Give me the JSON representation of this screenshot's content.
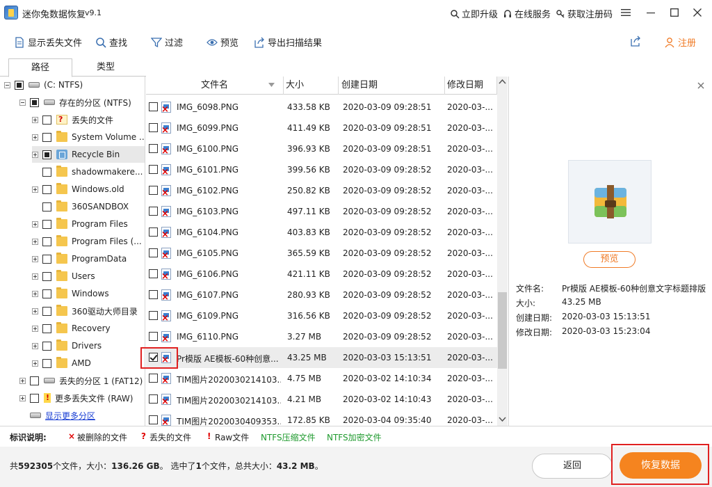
{
  "app": {
    "title": "迷你兔数据恢复",
    "version": "v9.1"
  },
  "titlebar": {
    "upgrade": "立即升级",
    "online_service": "在线服务",
    "get_code": "获取注册码"
  },
  "toolbar": {
    "show_lost": "显示丢失文件",
    "find": "查找",
    "filter": "过滤",
    "preview": "预览",
    "export": "导出扫描结果",
    "register": "注册"
  },
  "tabs": [
    "路径",
    "类型"
  ],
  "tree": [
    {
      "label": "(C: NTFS)",
      "icon": "drive",
      "check": "partial",
      "exp": "minus"
    },
    {
      "label": "存在的分区 (NTFS)",
      "icon": "drive",
      "check": "partial",
      "exp": "minus"
    },
    {
      "label": "丢失的文件",
      "icon": "lost",
      "check": "none",
      "exp": "plus"
    },
    {
      "label": "System Volume ...",
      "icon": "folder",
      "check": "none",
      "exp": "plus"
    },
    {
      "label": "Recycle Bin",
      "icon": "recycle",
      "check": "partial",
      "exp": "plus"
    },
    {
      "label": "shadowmakere...",
      "icon": "folder",
      "check": "none",
      "exp": "none"
    },
    {
      "label": "Windows.old",
      "icon": "folder",
      "check": "none",
      "exp": "plus"
    },
    {
      "label": "360SANDBOX",
      "icon": "folder",
      "check": "none",
      "exp": "none"
    },
    {
      "label": "Program Files",
      "icon": "folder",
      "check": "none",
      "exp": "plus"
    },
    {
      "label": "Program Files (...",
      "icon": "folder",
      "check": "none",
      "exp": "plus"
    },
    {
      "label": "ProgramData",
      "icon": "folder",
      "check": "none",
      "exp": "plus"
    },
    {
      "label": "Users",
      "icon": "folder",
      "check": "none",
      "exp": "plus"
    },
    {
      "label": "Windows",
      "icon": "folder",
      "check": "none",
      "exp": "plus"
    },
    {
      "label": "360驱动大师目录",
      "icon": "folder",
      "check": "none",
      "exp": "plus"
    },
    {
      "label": "Recovery",
      "icon": "folder",
      "check": "none",
      "exp": "plus"
    },
    {
      "label": "Drivers",
      "icon": "folder",
      "check": "none",
      "exp": "plus"
    },
    {
      "label": "AMD",
      "icon": "folder",
      "check": "none",
      "exp": "plus"
    },
    {
      "label": "丢失的分区 1 (FAT12)",
      "icon": "drive",
      "check": "none",
      "exp": "plus"
    },
    {
      "label": "更多丢失文件 (RAW)",
      "icon": "warn",
      "check": "none",
      "exp": "plus"
    },
    {
      "label": "显示更多分区",
      "icon": "drive",
      "check": "hidden",
      "exp": "none"
    }
  ],
  "list": {
    "headers": {
      "name": "文件名",
      "size": "大小",
      "created": "创建日期",
      "modified": "修改日期"
    },
    "rows": [
      {
        "name": "IMG_6098.PNG",
        "size": "433.58 KB",
        "created": "2020-03-09 09:28:51",
        "modified": "2020-03-...",
        "checked": false
      },
      {
        "name": "IMG_6099.PNG",
        "size": "411.49 KB",
        "created": "2020-03-09 09:28:51",
        "modified": "2020-03-...",
        "checked": false
      },
      {
        "name": "IMG_6100.PNG",
        "size": "396.93 KB",
        "created": "2020-03-09 09:28:51",
        "modified": "2020-03-...",
        "checked": false
      },
      {
        "name": "IMG_6101.PNG",
        "size": "399.56 KB",
        "created": "2020-03-09 09:28:52",
        "modified": "2020-03-...",
        "checked": false
      },
      {
        "name": "IMG_6102.PNG",
        "size": "250.82 KB",
        "created": "2020-03-09 09:28:52",
        "modified": "2020-03-...",
        "checked": false
      },
      {
        "name": "IMG_6103.PNG",
        "size": "497.11 KB",
        "created": "2020-03-09 09:28:52",
        "modified": "2020-03-...",
        "checked": false
      },
      {
        "name": "IMG_6104.PNG",
        "size": "403.83 KB",
        "created": "2020-03-09 09:28:52",
        "modified": "2020-03-...",
        "checked": false
      },
      {
        "name": "IMG_6105.PNG",
        "size": "365.59 KB",
        "created": "2020-03-09 09:28:52",
        "modified": "2020-03-...",
        "checked": false
      },
      {
        "name": "IMG_6106.PNG",
        "size": "421.11 KB",
        "created": "2020-03-09 09:28:52",
        "modified": "2020-03-...",
        "checked": false
      },
      {
        "name": "IMG_6107.PNG",
        "size": "280.93 KB",
        "created": "2020-03-09 09:28:52",
        "modified": "2020-03-...",
        "checked": false
      },
      {
        "name": "IMG_6109.PNG",
        "size": "316.56 KB",
        "created": "2020-03-09 09:28:52",
        "modified": "2020-03-...",
        "checked": false
      },
      {
        "name": "IMG_6110.PNG",
        "size": "3.27 MB",
        "created": "2020-03-09 09:28:52",
        "modified": "2020-03-...",
        "checked": false
      },
      {
        "name": "Pr模版 AE模板-60种创意...",
        "size": "43.25 MB",
        "created": "2020-03-03 15:13:51",
        "modified": "2020-03-...",
        "checked": true
      },
      {
        "name": "TIM图片2020030214103...",
        "size": "4.75 MB",
        "created": "2020-03-02 14:10:34",
        "modified": "2020-03-...",
        "checked": false
      },
      {
        "name": "TIM图片2020030214103...",
        "size": "4.21 MB",
        "created": "2020-03-02 14:10:43",
        "modified": "2020-03-...",
        "checked": false
      },
      {
        "name": "TIM图片2020030409353...",
        "size": "172.85 KB",
        "created": "2020-03-04 09:35:40",
        "modified": "2020-03-...",
        "checked": false
      }
    ]
  },
  "preview": {
    "button": "预览",
    "labels": [
      "文件名:",
      "大小:",
      "创建日期:",
      "修改日期:"
    ],
    "values": [
      "Pr模版 AE模板-60种创意文字标题排版",
      "43.25 MB",
      "2020-03-03 15:13:51",
      "2020-03-03 15:23:04"
    ]
  },
  "legend": {
    "title": "标识说明:",
    "deleted_mark": "×",
    "deleted": "被删除的文件",
    "lost_mark": "?",
    "lost": "丢失的文件",
    "raw_mark": "!",
    "raw": "Raw文件",
    "ntfs_compressed": "NTFS压缩文件",
    "ntfs_encrypted": "NTFS加密文件"
  },
  "status": {
    "prefix": "共",
    "total_files": "592305",
    "files_mid": "个文件，大小：",
    "total_size": "136.26 GB",
    "sel_prefix": "。 选中了",
    "sel_count": "1",
    "sel_mid": "个文件，总共大小：",
    "sel_size": "43.2 MB",
    "suffix": "。"
  },
  "buttons": {
    "back": "返回",
    "recover": "恢复数据"
  },
  "colors": {
    "accent": "#f5841f",
    "link": "#1a3fd4",
    "ntfs_green": "#1f9a2e",
    "mark_red": "#e00000"
  }
}
